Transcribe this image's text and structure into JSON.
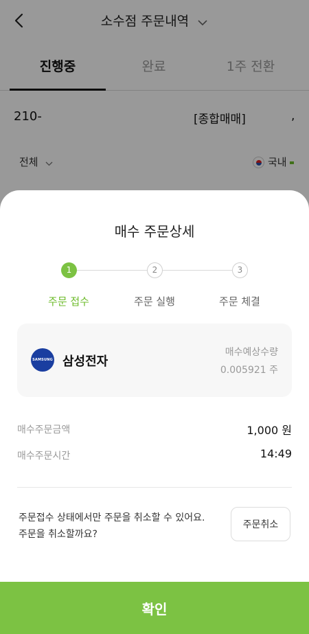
{
  "header": {
    "title": "소수점 주문내역"
  },
  "tabs": [
    {
      "label": "진행중"
    },
    {
      "label": "완료"
    },
    {
      "label": "1주 전환"
    }
  ],
  "account": {
    "number": "210-",
    "type": "[종합매매]",
    "trailing": ","
  },
  "filter": {
    "selected": "전체",
    "market": "국내"
  },
  "sheet": {
    "title": "매수 주문상세",
    "steps": [
      {
        "number": "1",
        "label": "주문 접수",
        "active": true
      },
      {
        "number": "2",
        "label": "주문 실행",
        "active": false
      },
      {
        "number": "3",
        "label": "주문 체결",
        "active": false
      }
    ],
    "stock": {
      "logo_text": "SAMSUNG",
      "name": "삼성전자",
      "qty_label": "매수예상수량",
      "qty_value": "0.005921 주"
    },
    "amount_label": "매수주문금액",
    "amount_value": "1,000 원",
    "time_label": "매수주문시간",
    "time_value": "14:49",
    "cancel_text_line1": "주문접수 상태에서만 주문을 취소할 수 있어요.",
    "cancel_text_line2": "주문을 취소할까요?",
    "cancel_button": "주문취소",
    "confirm_button": "확인"
  },
  "colors": {
    "accent": "#7cc243",
    "overlay": "rgba(0,0,0,0.40)"
  }
}
